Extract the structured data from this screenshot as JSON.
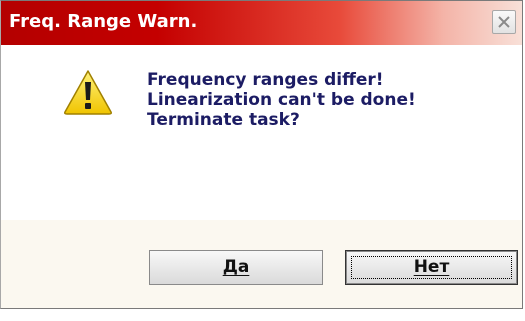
{
  "window": {
    "title": "Freq. Range Warn."
  },
  "message": {
    "lines": [
      "Frequency ranges differ!",
      "Linearization can't be done!",
      "Terminate task?"
    ]
  },
  "buttons": {
    "yes_label": "Да",
    "no_label": "Нет"
  },
  "icons": {
    "warning": "warning-triangle-icon",
    "close": "close-icon"
  },
  "colors": {
    "titlebar_start": "#b40000",
    "titlebar_end": "#f8e0d8",
    "message_text": "#1c1c64",
    "warning_fill": "#f5d000"
  }
}
